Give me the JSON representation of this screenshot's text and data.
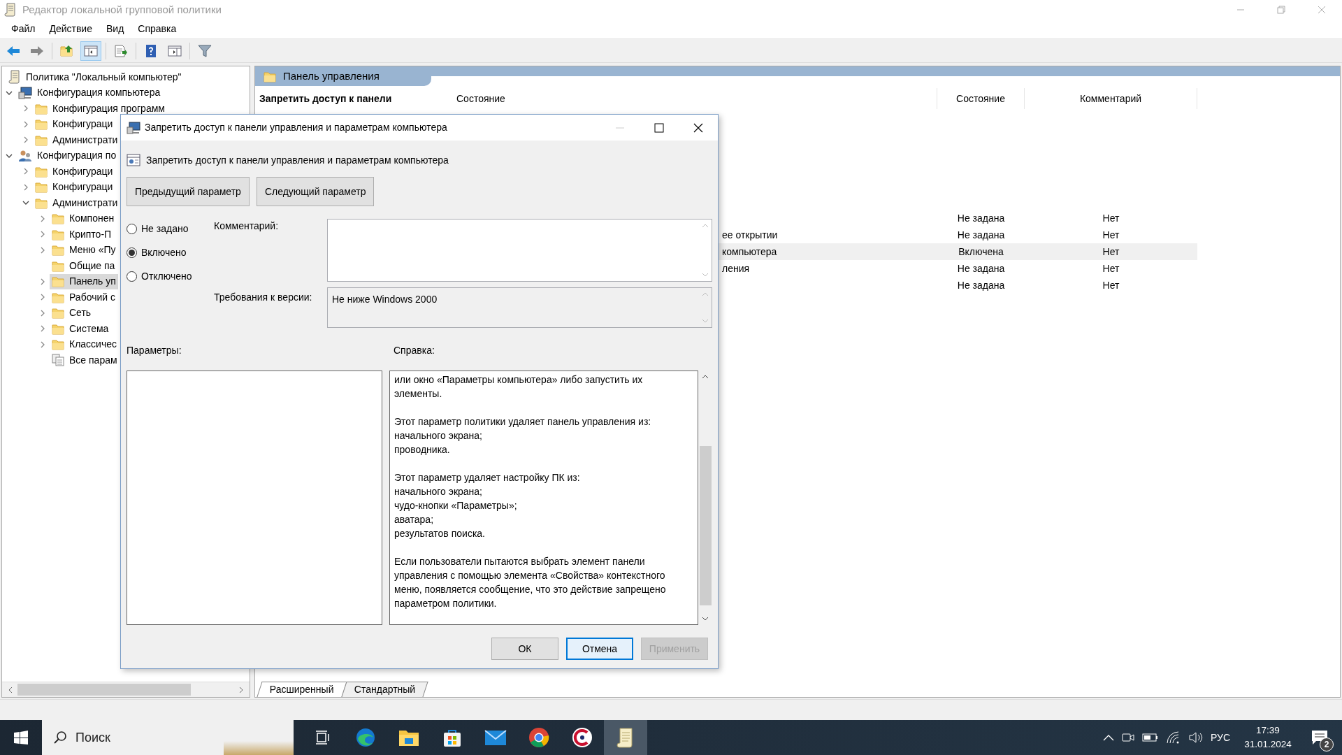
{
  "window": {
    "title": "Редактор локальной групповой политики"
  },
  "menu": [
    "Файл",
    "Действие",
    "Вид",
    "Справка"
  ],
  "toolbar": [
    {
      "kind": "back",
      "pressed": false
    },
    {
      "kind": "forward",
      "pressed": false
    },
    {
      "kind": "up",
      "pressed": false
    },
    {
      "kind": "tree",
      "pressed": true
    },
    {
      "kind": "export",
      "pressed": false
    },
    {
      "kind": "help",
      "pressed": false
    },
    {
      "kind": "pane",
      "pressed": false
    },
    {
      "kind": "filter",
      "pressed": false
    }
  ],
  "tree": [
    {
      "label": "Политика \"Локальный компьютер\"",
      "kind": "policy",
      "expandable": false,
      "selected": false,
      "children": [
        {
          "label": "Конфигурация компьютера",
          "kind": "computer",
          "expandable": true,
          "expanded": true,
          "selected": false,
          "children": [
            {
              "label": "Конфигурация программ",
              "kind": "folder",
              "expandable": true,
              "expanded": false,
              "selected": false
            },
            {
              "label": "Конфигураци",
              "kind": "folder",
              "expandable": true,
              "expanded": false,
              "selected": false
            },
            {
              "label": "Администрати",
              "kind": "folder",
              "expandable": true,
              "expanded": false,
              "selected": false
            }
          ]
        },
        {
          "label": "Конфигурация по",
          "kind": "user",
          "expandable": true,
          "expanded": true,
          "selected": false,
          "children": [
            {
              "label": "Конфигураци",
              "kind": "folder",
              "expandable": true,
              "expanded": false,
              "selected": false
            },
            {
              "label": "Конфигураци",
              "kind": "folder",
              "expandable": true,
              "expanded": false,
              "selected": false
            },
            {
              "label": "Администрати",
              "kind": "folder",
              "expandable": true,
              "expanded": true,
              "selected": false,
              "children": [
                {
                  "label": "Компонен",
                  "kind": "folder",
                  "expandable": true,
                  "expanded": false,
                  "selected": false
                },
                {
                  "label": "Крипто-П",
                  "kind": "folder",
                  "expandable": true,
                  "expanded": false,
                  "selected": false
                },
                {
                  "label": "Меню «Пу",
                  "kind": "folder",
                  "expandable": true,
                  "expanded": false,
                  "selected": false
                },
                {
                  "label": "Общие па",
                  "kind": "folder",
                  "expandable": false,
                  "selected": false
                },
                {
                  "label": "Панель уп",
                  "kind": "folder",
                  "expandable": true,
                  "expanded": false,
                  "selected": true
                },
                {
                  "label": "Рабочий с",
                  "kind": "folder",
                  "expandable": true,
                  "expanded": false,
                  "selected": false
                },
                {
                  "label": "Сеть",
                  "kind": "folder",
                  "expandable": true,
                  "expanded": false,
                  "selected": false
                },
                {
                  "label": "Система",
                  "kind": "folder",
                  "expandable": true,
                  "expanded": false,
                  "selected": false
                },
                {
                  "label": "Классичес",
                  "kind": "folder",
                  "expandable": true,
                  "expanded": false,
                  "selected": false
                },
                {
                  "label": "Все парам",
                  "kind": "settings",
                  "expandable": false,
                  "selected": false
                }
              ]
            }
          ]
        }
      ]
    }
  ],
  "details": {
    "header": "Панель управления",
    "description_title": "Запретить доступ к панели",
    "columns": [
      "Состояние",
      "Состояние",
      "Комментарий"
    ],
    "rows": [
      {
        "state": "Не задана",
        "comment": "Нет",
        "selected": false
      },
      {
        "name": "ее открытии",
        "state": "Не задана",
        "comment": "Нет",
        "selected": false
      },
      {
        "name": "компьютера",
        "state": "Включена",
        "comment": "Нет",
        "selected": true
      },
      {
        "name": "ления",
        "state": "Не задана",
        "comment": "Нет",
        "selected": false
      },
      {
        "state": "Не задана",
        "comment": "Нет",
        "selected": false
      }
    ]
  },
  "view_tabs": [
    {
      "label": "Расширенный",
      "selected": true
    },
    {
      "label": "Стандартный",
      "selected": false
    }
  ],
  "dialog": {
    "title": "Запретить доступ к панели управления и параметрам компьютера",
    "heading": "Запретить доступ к панели управления и параметрам компьютера",
    "nav_buttons": [
      "Предыдущий параметр",
      "Следующий параметр"
    ],
    "options": [
      {
        "label": "Не задано",
        "selected": false
      },
      {
        "label": "Включено",
        "selected": true
      },
      {
        "label": "Отключено",
        "selected": false
      }
    ],
    "comment_label": "Комментарий:",
    "version_label": "Требования к версии:",
    "version_value": "Не ниже Windows 2000",
    "parameters_label": "Параметры:",
    "help_label": "Справка:",
    "help_paragraphs": [
      [
        "или окно «Параметры компьютера» либо запустить их элементы."
      ],
      [
        "Этот параметр политики удаляет панель управления из:",
        "начального экрана;",
        "проводника."
      ],
      [
        "Этот параметр удаляет настройку ПК из:",
        "начального экрана;",
        "чудо-кнопки «Параметры»;",
        "аватара;",
        "результатов поиска."
      ],
      [
        "Если пользователи пытаются выбрать элемент панели управления с помощью элемента «Свойства» контекстного меню, появляется сообщение, что это действие запрещено параметром политики."
      ]
    ],
    "buttons": [
      {
        "label": "ОК",
        "focused": false,
        "disabled": false
      },
      {
        "label": "Отмена",
        "focused": true,
        "disabled": false
      },
      {
        "label": "Применить",
        "focused": false,
        "disabled": true
      }
    ]
  },
  "taskbar": {
    "search_placeholder": "Поиск",
    "apps": [
      {
        "kind": "taskview",
        "active": false
      },
      {
        "kind": "edge",
        "active": false
      },
      {
        "kind": "explorer",
        "active": false
      },
      {
        "kind": "store",
        "active": false
      },
      {
        "kind": "mail",
        "active": false
      },
      {
        "kind": "chrome",
        "active": false
      },
      {
        "kind": "ccleaner",
        "active": false
      },
      {
        "kind": "gpedit",
        "active": true
      }
    ],
    "language": "РУС",
    "time": "17:39",
    "date": "31.01.2024",
    "notifications": "2"
  }
}
